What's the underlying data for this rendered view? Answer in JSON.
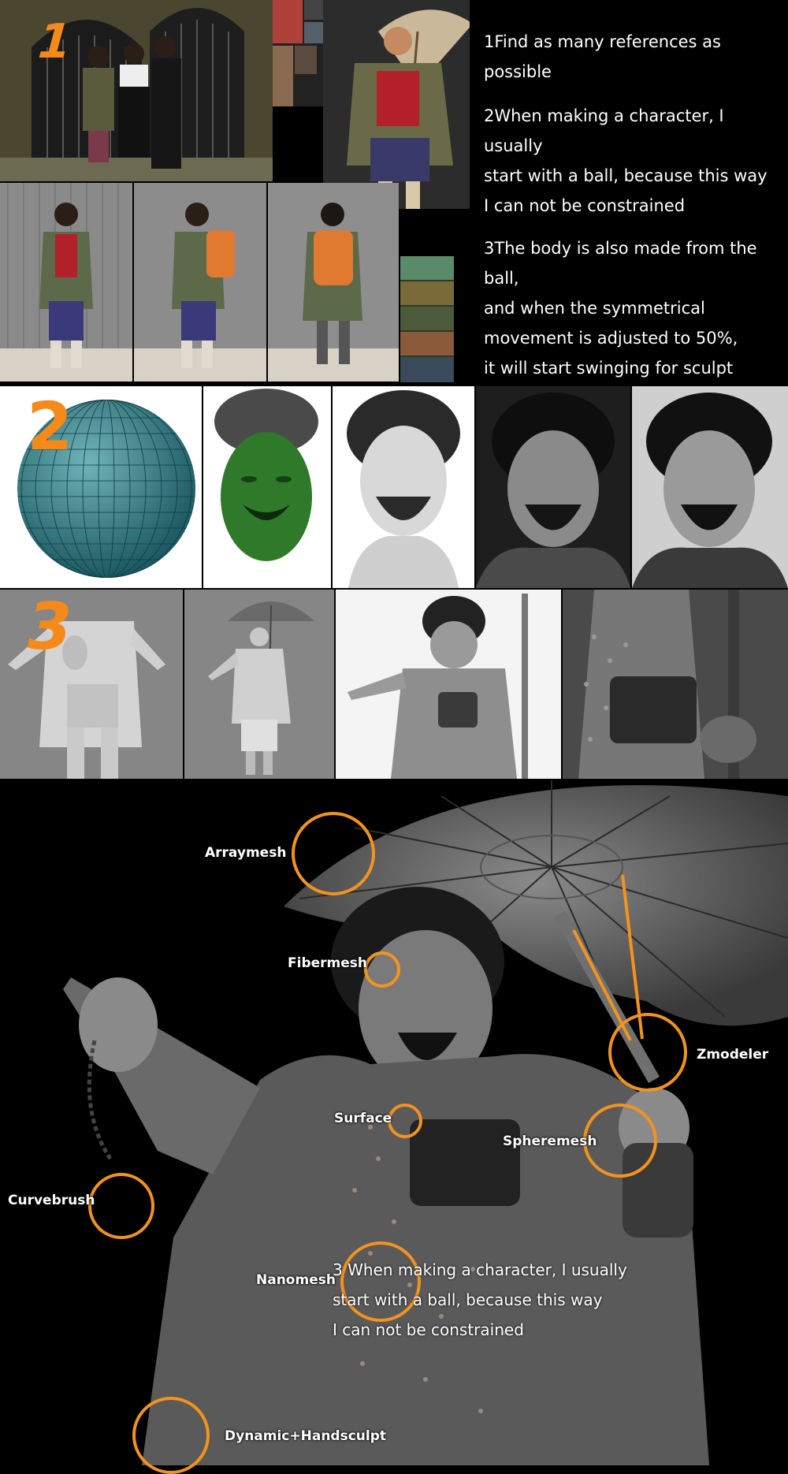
{
  "step_numbers": {
    "one": "1",
    "two": "2",
    "three": "3"
  },
  "steps_text": {
    "step1": "1Find as many references as possible",
    "step2_line1": "2When making a character, I usually",
    "step2_line2": "start with a ball, because this way",
    "step2_line3": "I can not be constrained",
    "step3_line1": "3The body is also made from the ball,",
    "step3_line2": "and when the symmetrical",
    "step3_line3": "movement is adjusted to 50%,",
    "step3_line4": "it will start swinging for sculpt"
  },
  "callouts": {
    "arraymesh": "Arraymesh",
    "fibermesh": "Fibermesh",
    "zmodeler": "Zmodeler",
    "surface": "Surface",
    "spheremesh": "Spheremesh",
    "curvebrush": "Curvebrush",
    "nanomesh": "Nanomesh",
    "dynamic_handsculpt": "Dynamic+Handsculpt"
  },
  "overlay_text": {
    "line1": "3 When making a character, I usually",
    "line2": "start with a ball, because this way",
    "line3": "I can not be constrained"
  },
  "colors": {
    "accent": "#f2931f",
    "background": "#000000",
    "text": "#ffffff"
  }
}
